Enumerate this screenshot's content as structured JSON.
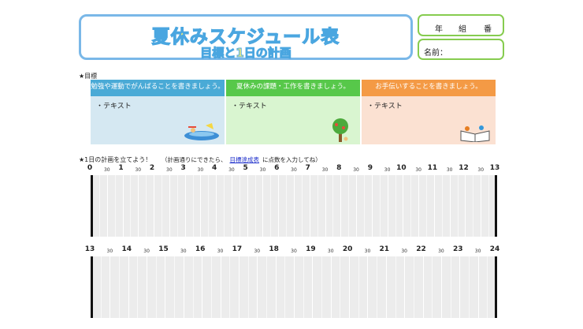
{
  "header": {
    "title": "夏休みスケジュール表",
    "subtitle": "目標と1日の計画",
    "year_label": "年",
    "class_label": "組",
    "number_label": "番",
    "name_label": "名前："
  },
  "goals": {
    "section_label": "★目標",
    "columns": [
      {
        "header": "勉強や運動でがんばることを書きましょう。",
        "item": "・テキスト",
        "color": "#4aaad6",
        "bg": "#d5e8f2",
        "illustration": "swimming-pool-icon"
      },
      {
        "header": "夏休みの課題・工作を書きましょう。",
        "item": "・テキスト",
        "color": "#57c84a",
        "bg": "#d9f5d0",
        "illustration": "tree-icon"
      },
      {
        "header": "お手伝いすることを書きましょう。",
        "item": "・テキスト",
        "color": "#f49a45",
        "bg": "#fbe1d2",
        "illustration": "open-book-icon"
      }
    ]
  },
  "plan": {
    "label": "★1日の計画を立てよう！",
    "note_prefix": "（計画通りにできたら、",
    "note_link": "目標達成表",
    "note_suffix": "に点数を入力してね）"
  },
  "timeline_top": {
    "hours": [
      "0",
      "1",
      "2",
      "3",
      "4",
      "5",
      "6",
      "7",
      "8",
      "9",
      "10",
      "11",
      "12",
      "13"
    ],
    "half": "30"
  },
  "timeline_bottom": {
    "hours": [
      "13",
      "14",
      "15",
      "16",
      "17",
      "18",
      "19",
      "20",
      "21",
      "22",
      "23",
      "24"
    ],
    "half": "30"
  }
}
